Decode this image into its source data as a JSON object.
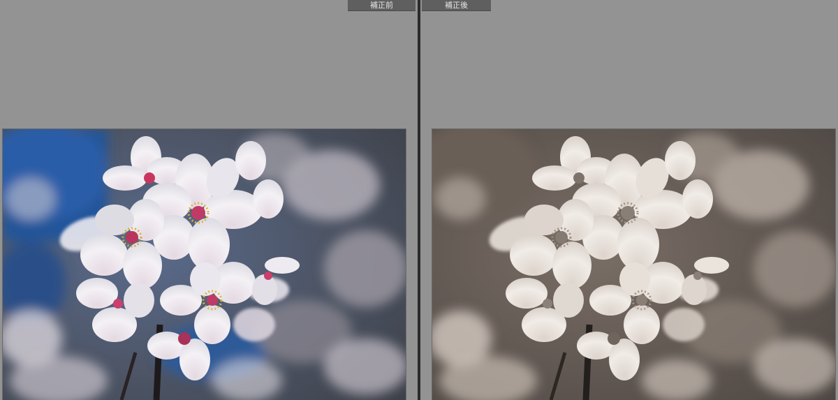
{
  "labels": {
    "before": "補正前",
    "after": "補正後"
  },
  "colors": {
    "app_background": "#939393",
    "divider": "#2b2b2b",
    "label_bg": "#5f5f5f",
    "label_text": "#e6e6e6",
    "sky_blue": "#2c4f86",
    "petal_white": "#f2eef2",
    "petal_pink": "#d23a6a",
    "stamen_yellow": "#d8b43a"
  },
  "images": {
    "before_icon": "cherry-blossom-photo",
    "after_icon": "cherry-blossom-sepia-photo"
  }
}
